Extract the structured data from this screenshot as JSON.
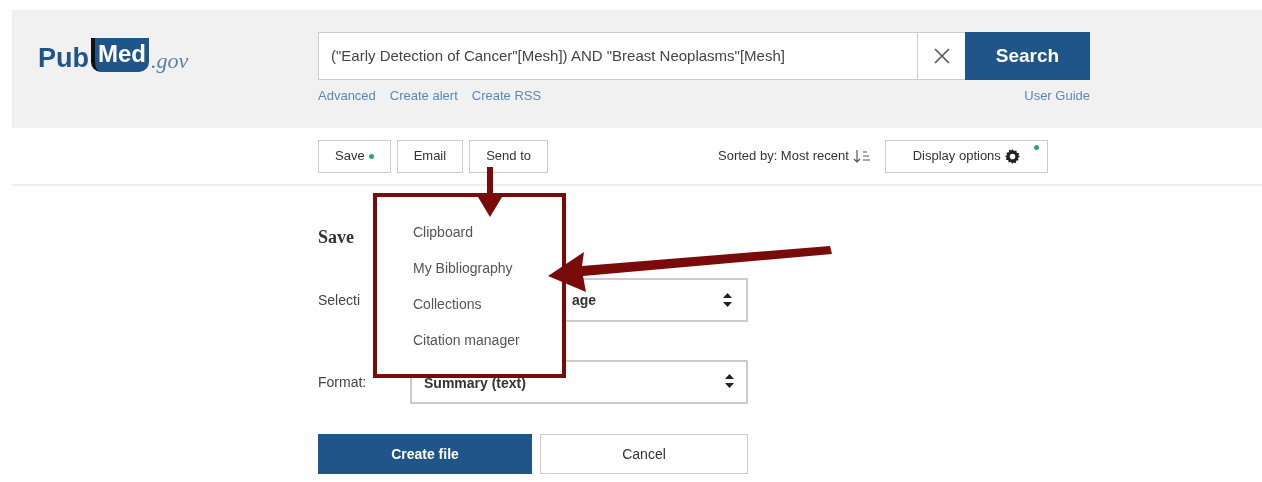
{
  "logo": {
    "left": "Pub",
    "middle": "Med",
    "suffix": ".gov"
  },
  "search": {
    "value": "(\"Early Detection of Cancer\"[Mesh]) AND \"Breast Neoplasms\"[Mesh]",
    "button": "Search",
    "links": [
      "Advanced",
      "Create alert",
      "Create RSS"
    ],
    "user_guide": "User Guide"
  },
  "toolbar": {
    "buttons": [
      "Save",
      "Email",
      "Send to"
    ],
    "sort": "Sorted by: Most recent",
    "display_options": "Display options"
  },
  "form": {
    "heading": "Save",
    "selection_label": "Selecti",
    "selection_value": "age",
    "format_label": "Format:",
    "format_value": "Summary (text)",
    "buttons": [
      "Create file",
      "Cancel"
    ]
  },
  "send_to_menu": [
    "Clipboard",
    "My Bibliography",
    "Collections",
    "Citation manager"
  ]
}
